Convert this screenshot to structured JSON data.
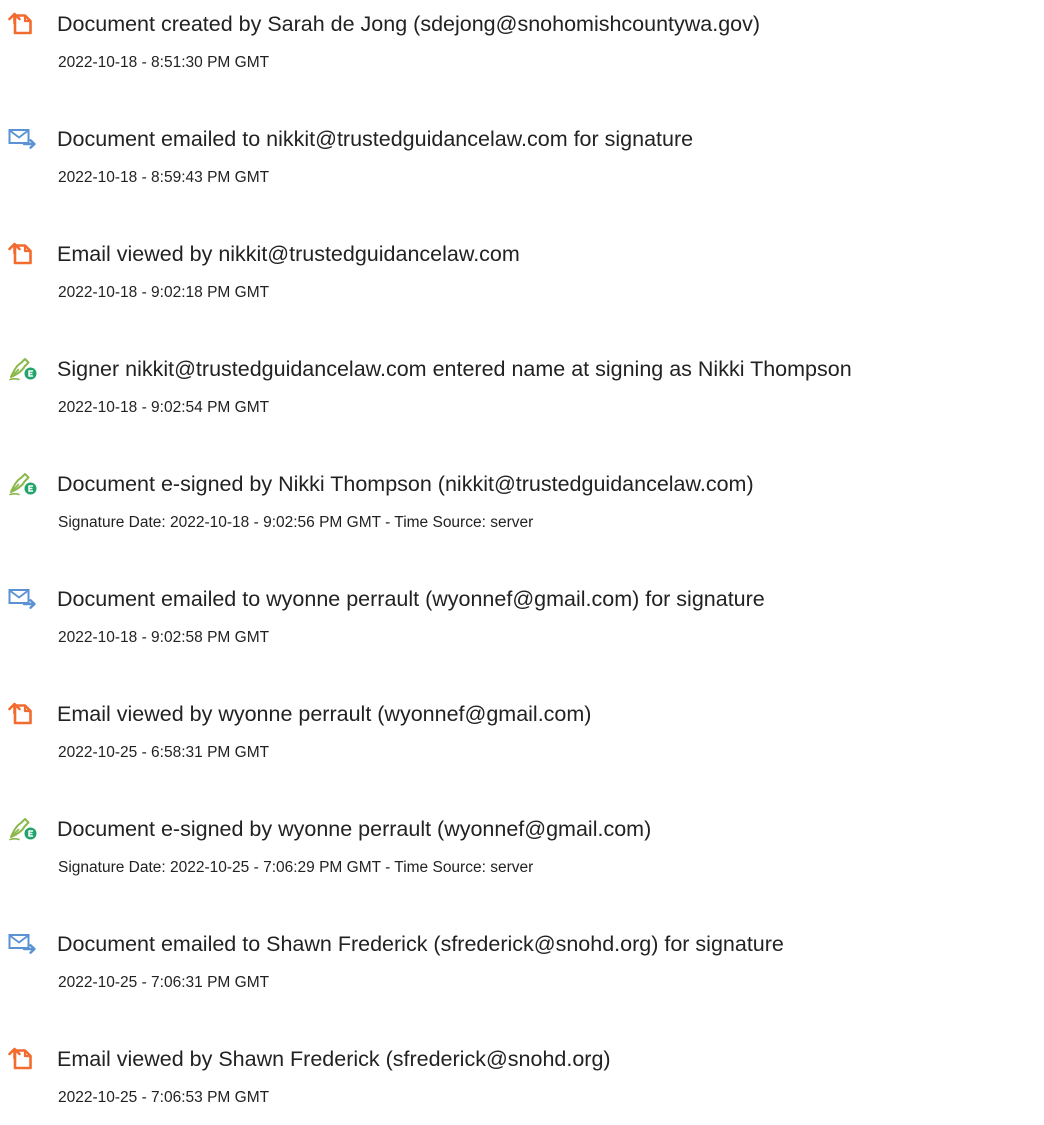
{
  "events": [
    {
      "icon": "document-created-icon",
      "title": "Document created by Sarah de Jong (sdejong@snohomishcountywa.gov)",
      "subtitle": "2022-10-18 - 8:51:30 PM GMT"
    },
    {
      "icon": "email-sent-icon",
      "title": "Document emailed to nikkit@trustedguidancelaw.com for signature",
      "subtitle": "2022-10-18 - 8:59:43 PM GMT"
    },
    {
      "icon": "document-viewed-icon",
      "title": "Email viewed by nikkit@trustedguidancelaw.com",
      "subtitle": "2022-10-18 - 9:02:18 PM GMT"
    },
    {
      "icon": "e-sign-pen-icon",
      "title": "Signer nikkit@trustedguidancelaw.com entered name at signing as Nikki Thompson",
      "subtitle": "2022-10-18 - 9:02:54 PM GMT"
    },
    {
      "icon": "e-sign-pen-icon",
      "title": "Document e-signed by Nikki Thompson (nikkit@trustedguidancelaw.com)",
      "subtitle": "Signature Date: 2022-10-18 - 9:02:56 PM GMT - Time Source: server"
    },
    {
      "icon": "email-sent-icon",
      "title": "Document emailed to wyonne perrault (wyonnef@gmail.com) for signature",
      "subtitle": "2022-10-18 - 9:02:58 PM GMT"
    },
    {
      "icon": "document-viewed-icon",
      "title": "Email viewed by wyonne perrault (wyonnef@gmail.com)",
      "subtitle": "2022-10-25 - 6:58:31 PM GMT"
    },
    {
      "icon": "e-sign-pen-icon",
      "title": "Document e-signed by wyonne perrault (wyonnef@gmail.com)",
      "subtitle": "Signature Date: 2022-10-25 - 7:06:29 PM GMT - Time Source: server"
    },
    {
      "icon": "email-sent-icon",
      "title": "Document emailed to Shawn Frederick (sfrederick@snohd.org) for signature",
      "subtitle": "2022-10-25 - 7:06:31 PM GMT"
    },
    {
      "icon": "document-viewed-icon",
      "title": "Email viewed by Shawn Frederick (sfrederick@snohd.org)",
      "subtitle": "2022-10-25 - 7:06:53 PM GMT"
    }
  ],
  "colors": {
    "document_icon": "#f26b2f",
    "email_icon": "#5b92d4",
    "sign_pen": "#8ab84a",
    "sign_badge": "#21a36b",
    "text": "#222222"
  }
}
